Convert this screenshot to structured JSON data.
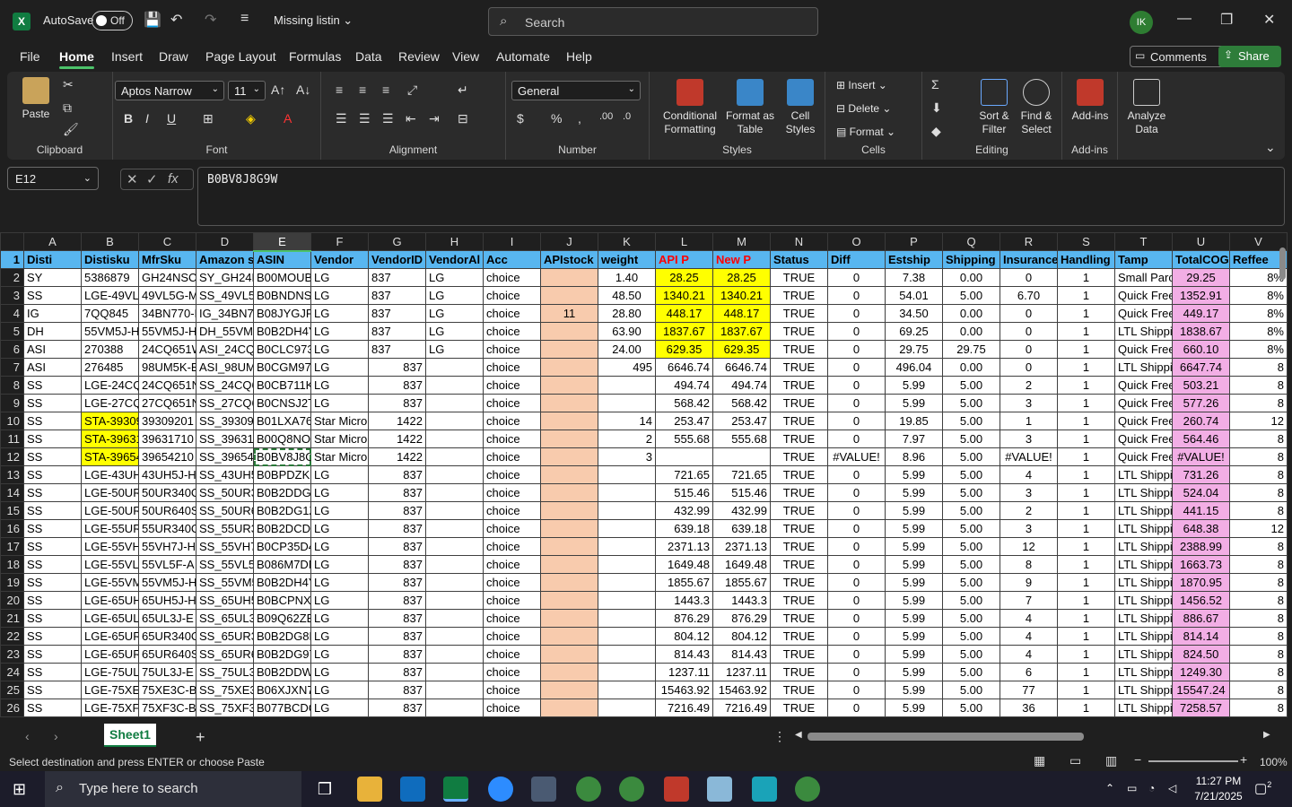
{
  "titlebar": {
    "logo": "X",
    "autosave_label": "AutoSave",
    "autosave_state": "Off",
    "doc_title": "Missing listin",
    "search_placeholder": "Search",
    "user_initials": "IK"
  },
  "menu": [
    "File",
    "Home",
    "Insert",
    "Draw",
    "Page Layout",
    "Formulas",
    "Data",
    "Review",
    "View",
    "Automate",
    "Help"
  ],
  "menu_active": "Home",
  "comments_label": "Comments",
  "share_label": "Share",
  "ribbon": {
    "clipboard": {
      "paste": "Paste",
      "label": "Clipboard"
    },
    "font": {
      "name": "Aptos Narrow",
      "size": "11",
      "label": "Font"
    },
    "alignment": {
      "label": "Alignment"
    },
    "number": {
      "format": "General",
      "label": "Number"
    },
    "styles": {
      "conditional": "Conditional Formatting",
      "format_table": "Format as Table",
      "cell_styles": "Cell Styles",
      "label": "Styles"
    },
    "cells": {
      "insert": "Insert",
      "delete": "Delete",
      "format": "Format",
      "label": "Cells"
    },
    "editing": {
      "sort": "Sort & Filter",
      "find": "Find & Select",
      "label": "Editing"
    },
    "addins": {
      "addins": "Add-ins",
      "label": "Add-ins"
    },
    "analyze": {
      "label": "Analyze Data"
    }
  },
  "formula": {
    "namebox": "E12",
    "fx": "fx",
    "content": "B0BV8J8G9W"
  },
  "columns": [
    "A",
    "B",
    "C",
    "D",
    "E",
    "F",
    "G",
    "H",
    "I",
    "J",
    "K",
    "L",
    "M",
    "N",
    "O",
    "P",
    "Q",
    "R",
    "S",
    "T",
    "U",
    "V"
  ],
  "rows": [
    [
      "Disti",
      "Distisku",
      "MfrSku",
      "Amazon s",
      "ASIN",
      "Vendor",
      "VendorID",
      "VendorAl",
      "Acc",
      "APIstock",
      "weight",
      "API P",
      "New P",
      "Status",
      "Diff",
      "Estship",
      "Shipping",
      "Insurance",
      "Handling",
      "Tamp",
      "TotalCOG",
      "Reffee"
    ],
    [
      "SY",
      "5386879",
      "GH24NSC0",
      "SY_GH24N",
      "B00MOUB",
      "LG",
      "837",
      "LG",
      "choice",
      "",
      "1.40",
      "28.25",
      "28.25",
      "TRUE",
      "0",
      "7.38",
      "0.00",
      "0",
      "1",
      "Small Parc",
      "29.25",
      "8%"
    ],
    [
      "SS",
      "LGE-49VL5",
      "49VL5G-M",
      "SS_49VL5G",
      "B0BNDNS",
      "LG",
      "837",
      "LG",
      "choice",
      "",
      "48.50",
      "1340.21",
      "1340.21",
      "TRUE",
      "0",
      "54.01",
      "5.00",
      "6.70",
      "1",
      "Quick Free",
      "1352.91",
      "8%"
    ],
    [
      "IG",
      "7QQ845",
      "34BN770-I",
      "IG_34BN77",
      "B08JYGJP3",
      "LG",
      "837",
      "LG",
      "choice",
      "11",
      "28.80",
      "448.17",
      "448.17",
      "TRUE",
      "0",
      "34.50",
      "0.00",
      "0",
      "1",
      "Quick Free",
      "449.17",
      "8%"
    ],
    [
      "DH",
      "55VM5J-H",
      "55VM5J-H",
      "DH_55VM5",
      "B0B2DH4Y",
      "LG",
      "837",
      "LG",
      "choice",
      "",
      "63.90",
      "1837.67",
      "1837.67",
      "TRUE",
      "0",
      "69.25",
      "0.00",
      "0",
      "1",
      "LTL Shippi",
      "1838.67",
      "8%"
    ],
    [
      "ASI",
      "270388",
      "24CQ651W",
      "ASI_24CQ6",
      "B0CLC973I",
      "LG",
      "837",
      "LG",
      "choice",
      "",
      "24.00",
      "629.35",
      "629.35",
      "TRUE",
      "0",
      "29.75",
      "29.75",
      "0",
      "1",
      "Quick Free",
      "660.10",
      "8%"
    ],
    [
      "ASI",
      "276485",
      "98UM5K-B",
      "ASI_98UM5",
      "B0CGM97V",
      "LG",
      "837",
      "",
      "choice",
      "",
      "495",
      "6646.74",
      "6646.74",
      "TRUE",
      "0",
      "496.04",
      "0.00",
      "0",
      "1",
      "LTL Shippi",
      "6647.74",
      "8"
    ],
    [
      "SS",
      "LGE-24CQ6",
      "24CQ651N",
      "SS_24CQ65",
      "B0CB711K",
      "LG",
      "837",
      "",
      "choice",
      "",
      "",
      "494.74",
      "494.74",
      "TRUE",
      "0",
      "5.99",
      "5.00",
      "2",
      "1",
      "Quick Free",
      "503.21",
      "8"
    ],
    [
      "SS",
      "LGE-27CQ6",
      "27CQ651N",
      "SS_27CQ65",
      "B0CNSJ2T",
      "LG",
      "837",
      "",
      "choice",
      "",
      "",
      "568.42",
      "568.42",
      "TRUE",
      "0",
      "5.99",
      "5.00",
      "3",
      "1",
      "Quick Free",
      "577.26",
      "8"
    ],
    [
      "SS",
      "STA-39309",
      "39309201",
      "SS_393092",
      "B01LXA76",
      "Star Micro",
      "1422",
      "",
      "choice",
      "",
      "14",
      "253.47",
      "253.47",
      "TRUE",
      "0",
      "19.85",
      "5.00",
      "1",
      "1",
      "Quick Free",
      "260.74",
      "12"
    ],
    [
      "SS",
      "STA-39631",
      "39631710",
      "SS_396317",
      "B00Q8NO",
      "Star Micro",
      "1422",
      "",
      "choice",
      "",
      "2",
      "555.68",
      "555.68",
      "TRUE",
      "0",
      "7.97",
      "5.00",
      "3",
      "1",
      "Quick Free",
      "564.46",
      "8"
    ],
    [
      "SS",
      "STA-39654",
      "39654210",
      "SS_396542",
      "B0BV8J8G",
      "Star Micro",
      "1422",
      "",
      "choice",
      "",
      "3",
      "",
      "",
      "TRUE",
      "#VALUE!",
      "8.96",
      "5.00",
      "#VALUE!",
      "1",
      "Quick Free",
      "#VALUE!",
      "8"
    ],
    [
      "SS",
      "LGE-43UH5",
      "43UH5J-H",
      "SS_43UH5J",
      "B0BPDZKP",
      "LG",
      "837",
      "",
      "choice",
      "",
      "",
      "721.65",
      "721.65",
      "TRUE",
      "0",
      "5.99",
      "5.00",
      "4",
      "1",
      "LTL Shippi",
      "731.26",
      "8"
    ],
    [
      "SS",
      "LGE-50UR3",
      "50UR340C",
      "SS_50UR34",
      "B0B2DDG1",
      "LG",
      "837",
      "",
      "choice",
      "",
      "",
      "515.46",
      "515.46",
      "TRUE",
      "0",
      "5.99",
      "5.00",
      "3",
      "1",
      "LTL Shippi",
      "524.04",
      "8"
    ],
    [
      "SS",
      "LGE-50UR6",
      "50UR640S",
      "SS_50UR64",
      "B0B2DG1Z",
      "LG",
      "837",
      "",
      "choice",
      "",
      "",
      "432.99",
      "432.99",
      "TRUE",
      "0",
      "5.99",
      "5.00",
      "2",
      "1",
      "LTL Shippi",
      "441.15",
      "8"
    ],
    [
      "SS",
      "LGE-55UR3",
      "55UR340C",
      "SS_55UR34",
      "B0B2DCDK",
      "LG",
      "837",
      "",
      "choice",
      "",
      "",
      "639.18",
      "639.18",
      "TRUE",
      "0",
      "5.99",
      "5.00",
      "3",
      "1",
      "LTL Shippi",
      "648.38",
      "12"
    ],
    [
      "SS",
      "LGE-55VH7",
      "55VH7J-H",
      "SS_55VH7J",
      "B0CP35D4",
      "LG",
      "837",
      "",
      "choice",
      "",
      "",
      "2371.13",
      "2371.13",
      "TRUE",
      "0",
      "5.99",
      "5.00",
      "12",
      "1",
      "LTL Shippi",
      "2388.99",
      "8"
    ],
    [
      "SS",
      "LGE-55VL5",
      "55VL5F-A",
      "SS_55VL5F",
      "B086M7DN",
      "LG",
      "837",
      "",
      "choice",
      "",
      "",
      "1649.48",
      "1649.48",
      "TRUE",
      "0",
      "5.99",
      "5.00",
      "8",
      "1",
      "LTL Shippi",
      "1663.73",
      "8"
    ],
    [
      "SS",
      "LGE-55VM",
      "55VM5J-H",
      "SS_55VM5",
      "B0B2DH4Y",
      "LG",
      "837",
      "",
      "choice",
      "",
      "",
      "1855.67",
      "1855.67",
      "TRUE",
      "0",
      "5.99",
      "5.00",
      "9",
      "1",
      "LTL Shippi",
      "1870.95",
      "8"
    ],
    [
      "SS",
      "LGE-65UH5",
      "65UH5J-H",
      "SS_65UH5J",
      "B0BCPNXN",
      "LG",
      "837",
      "",
      "choice",
      "",
      "",
      "1443.3",
      "1443.3",
      "TRUE",
      "0",
      "5.99",
      "5.00",
      "7",
      "1",
      "LTL Shippi",
      "1456.52",
      "8"
    ],
    [
      "SS",
      "LGE-65UL3",
      "65UL3J-E",
      "SS_65UL3J",
      "B09Q62ZB",
      "LG",
      "837",
      "",
      "choice",
      "",
      "",
      "876.29",
      "876.29",
      "TRUE",
      "0",
      "5.99",
      "5.00",
      "4",
      "1",
      "LTL Shippi",
      "886.67",
      "8"
    ],
    [
      "SS",
      "LGE-65UR3",
      "65UR340C",
      "SS_65UR34",
      "B0B2DG8P",
      "LG",
      "837",
      "",
      "choice",
      "",
      "",
      "804.12",
      "804.12",
      "TRUE",
      "0",
      "5.99",
      "5.00",
      "4",
      "1",
      "LTL Shippi",
      "814.14",
      "8"
    ],
    [
      "SS",
      "LGE-65UR6",
      "65UR640S",
      "SS_65UR64",
      "B0B2DG97",
      "LG",
      "837",
      "",
      "choice",
      "",
      "",
      "814.43",
      "814.43",
      "TRUE",
      "0",
      "5.99",
      "5.00",
      "4",
      "1",
      "LTL Shippi",
      "824.50",
      "8"
    ],
    [
      "SS",
      "LGE-75UL3",
      "75UL3J-E",
      "SS_75UL3J",
      "B0B2DDW",
      "LG",
      "837",
      "",
      "choice",
      "",
      "",
      "1237.11",
      "1237.11",
      "TRUE",
      "0",
      "5.99",
      "5.00",
      "6",
      "1",
      "LTL Shippi",
      "1249.30",
      "8"
    ],
    [
      "SS",
      "LGE-75XE3",
      "75XE3C-B",
      "SS_75XE3C",
      "B06XJXN7",
      "LG",
      "837",
      "",
      "choice",
      "",
      "",
      "15463.92",
      "15463.92",
      "TRUE",
      "0",
      "5.99",
      "5.00",
      "77",
      "1",
      "LTL Shippi",
      "15547.24",
      "8"
    ],
    [
      "SS",
      "LGE-75XF3",
      "75XF3C-B",
      "SS_75XF3C",
      "B077BCDG",
      "LG",
      "837",
      "",
      "choice",
      "",
      "",
      "7216.49",
      "7216.49",
      "TRUE",
      "0",
      "5.99",
      "5.00",
      "36",
      "1",
      "LTL Shippi",
      "7258.57",
      "8"
    ]
  ],
  "sheet_tab": "Sheet1",
  "status_text": "Select destination and press ENTER or choose Paste",
  "zoom": "100%",
  "taskbar": {
    "search_placeholder": "Type here to search",
    "time": "11:27 PM",
    "date": "7/21/2025",
    "notif_count": "2"
  },
  "colors": {
    "accent": "#107c41",
    "header_blue": "#58b6f0",
    "yellow": "#ffff00",
    "peach": "#f8cbad",
    "pink": "#f2aee5"
  }
}
